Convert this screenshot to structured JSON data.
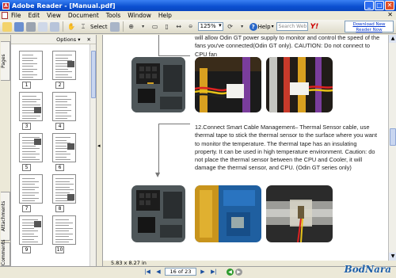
{
  "window": {
    "title": "Adobe Reader - [Manual.pdf]",
    "minimize": "_",
    "maximize": "□",
    "close": "✕"
  },
  "menu": {
    "items": [
      "File",
      "Edit",
      "View",
      "Document",
      "Tools",
      "Window",
      "Help"
    ],
    "close_doc": "✕"
  },
  "toolbar": {
    "select_label": "Select",
    "zoom_value": "125%",
    "help_label": "Help",
    "search_placeholder": "Search Web",
    "yahoo": "Y!",
    "download_link": "Download New Reader Now"
  },
  "left_panel": {
    "tabs": [
      "Pages",
      "Attachments",
      "Comments"
    ],
    "options_label": "Options",
    "close": "✕",
    "page_numbers": [
      "1",
      "2",
      "3",
      "4",
      "5",
      "6",
      "7",
      "8",
      "9",
      "10"
    ]
  },
  "document": {
    "paragraph1": "will allow Odin GT power supply to monitor and control the speed of the fans you've connected(Odin GT only). CAUTION: Do not connect to CPU fan",
    "paragraph2": "12.Connect Smart Cable Management– Thermal Sensor cable, use thermal tape to stick the thermal sensor to the surface where you want to monitor the temperature. The thermal tape has an insulating property. It can be used in high temperature environment.  Caution: do not place the thermal sensor between the CPU and Cooler, it will damage the thermal sensor, and CPU. (Odin GT series only)",
    "page_size": "5.83 x 8.27 in"
  },
  "navigation": {
    "first": "|◀",
    "prev": "◀",
    "page_indicator": "16 of 23",
    "next": "▶",
    "last": "▶|"
  },
  "watermark": "BodNara",
  "colors": {
    "titlebar": "#0b4fd0",
    "text": "#222222",
    "link": "#0033cc"
  }
}
